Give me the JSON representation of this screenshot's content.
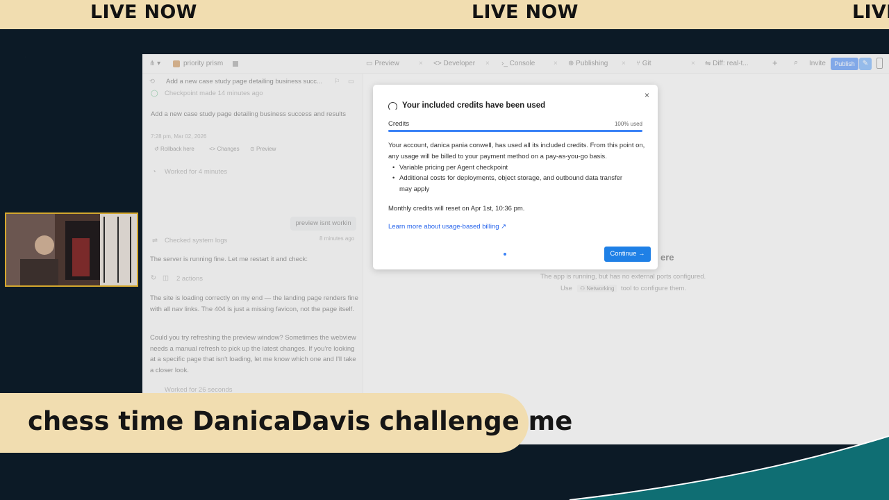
{
  "ticker": [
    "LIVE NOW",
    "LIVE NOW",
    "LIVE"
  ],
  "banner_text": "chess time DanicaDavis challenge me",
  "topbar": {
    "project": "priority prism",
    "tabs": [
      "Preview",
      "Developer",
      "Console",
      "Publishing",
      "Git",
      "Diff: real-t..."
    ],
    "invite": "Invite",
    "publish": "Publish"
  },
  "chat": {
    "task_title": "Add a new case study page detailing business succ...",
    "checkpoint": "Checkpoint made 14 minutes ago",
    "message": "Add a new case study page detailing business success and results",
    "timestamp": "7:28 pm, Mar 02, 2026",
    "actions": [
      "Rollback here",
      "Changes",
      "Preview"
    ],
    "worked1": "Worked for 4 minutes",
    "user_msg": "preview isnt workin",
    "user_time": "8 minutes ago",
    "checked": "Checked system logs",
    "reply1": "The server is running fine. Let me restart it and check:",
    "actions_count": "2 actions",
    "reply2": "The site is loading correctly on my end — the landing page renders fine with all nav links. The 404 is just a missing favicon, not the page itself.",
    "reply3": "Could you try refreshing the preview window? Sometimes the webview needs a manual refresh to pick up the latest changes. If you're looking at a specific page that isn't loading, let me know which one and I'll take a closer look.",
    "worked2": "Worked for 26 seconds"
  },
  "preview": {
    "heading_fragment": "ere",
    "running_text": "The app is running, but has no external ports configured.",
    "use": "Use",
    "networking": "Networking",
    "configure": "tool to configure them."
  },
  "modal": {
    "title": "Your included credits have been used",
    "credits_label": "Credits",
    "used_label": "100% used",
    "used_fraction": 1.0,
    "body": "Your account, danica pania conwell, has used all its included credits. From this point on, any usage will be billed to your payment method on a pay-as-you-go basis.",
    "bullets": [
      "Variable pricing per Agent checkpoint",
      "Additional costs for deployments, object storage, and outbound data transfer may apply"
    ],
    "reset": "Monthly credits will reset on Apr 1st, 10:36 pm.",
    "learn_more": "Learn more about usage-based billing",
    "continue": "Continue"
  },
  "colors": {
    "banner": "#f1ddb0",
    "accent": "#1f80e6",
    "background": "#0c1a26",
    "teal": "#0f6e73"
  }
}
